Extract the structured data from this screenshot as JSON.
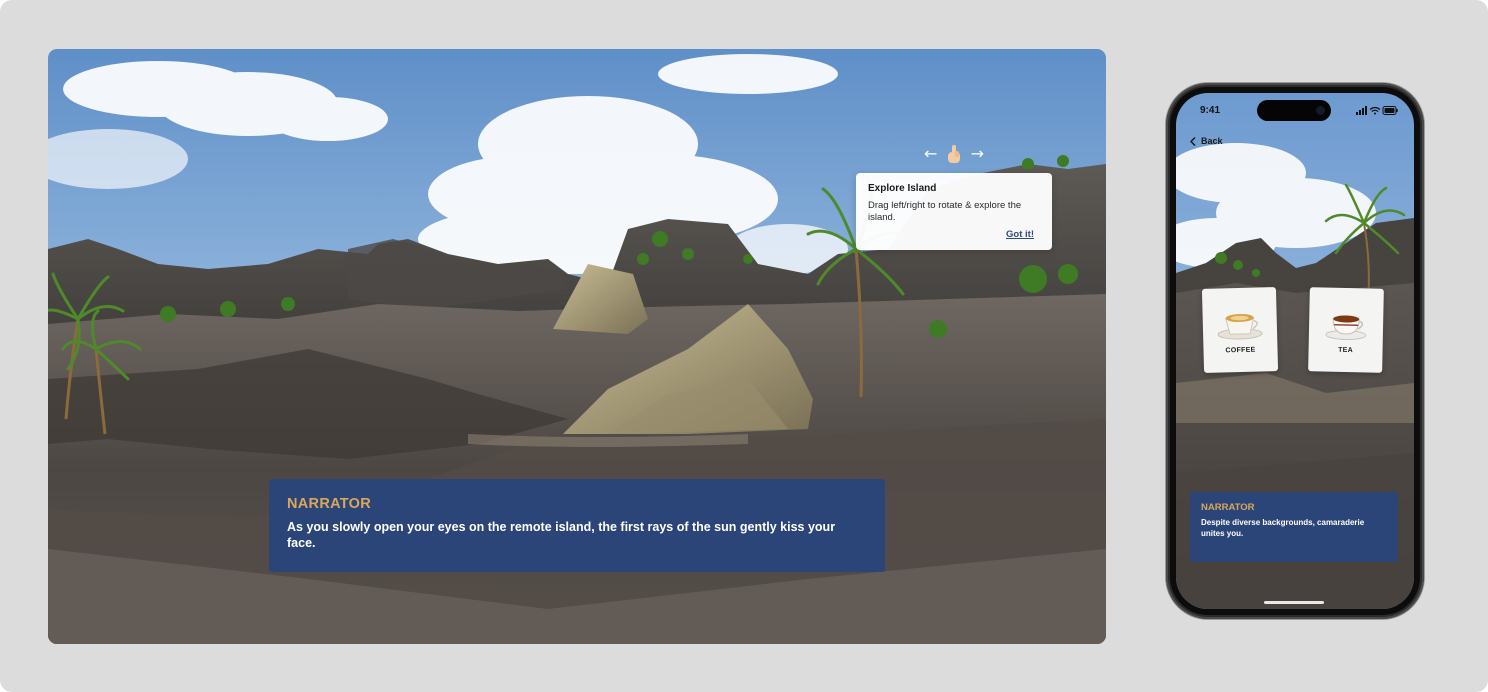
{
  "desktop": {
    "tooltip": {
      "title": "Explore Island",
      "body": "Drag left/right to rotate & explore the island.",
      "action": "Got it!"
    },
    "swipe_hint": {
      "left_arrow": "←",
      "right_arrow": "→"
    },
    "narrator": {
      "speaker": "NARRATOR",
      "text": "As you slowly open your eyes on the remote island, the first rays of the sun gently kiss your face."
    }
  },
  "phone": {
    "status_time": "9:41",
    "back_label": "Back",
    "choices": [
      {
        "label": "COFFEE",
        "icon": "coffee-cup-icon"
      },
      {
        "label": "TEA",
        "icon": "tea-cup-icon"
      }
    ],
    "narrator": {
      "speaker": "NARRATOR",
      "text": "Despite diverse backgrounds, camaraderie unites you."
    }
  },
  "colors": {
    "page_background": "#dcdcdc",
    "dialog_background": "#2b4579",
    "speaker_name": "#d9a85b",
    "link": "#2f4a86"
  }
}
